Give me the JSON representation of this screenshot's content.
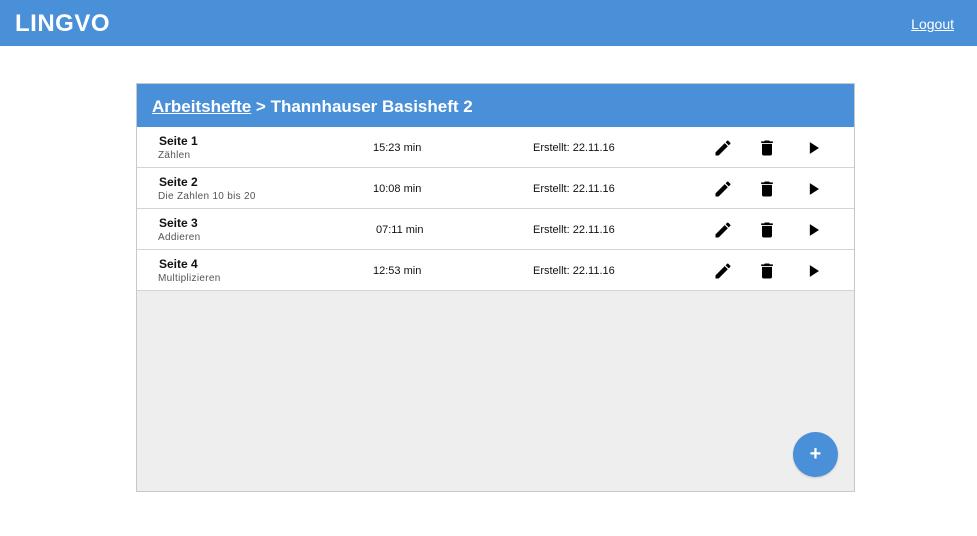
{
  "app": {
    "brand": "LINGVO",
    "logout_label": "Logout"
  },
  "panel": {
    "breadcrumb_link": "Arbeitshefte",
    "breadcrumb_separator": " > ",
    "breadcrumb_current": "Thannhauser Basisheft 2",
    "add_label": "+"
  },
  "rows": [
    {
      "title": "Seite 1",
      "subtitle": "Zählen",
      "duration": "15:23 min",
      "created": "Erstellt: 22.11.16"
    },
    {
      "title": "Seite 2",
      "subtitle": "Die Zahlen 10 bis 20",
      "duration": "10:08 min",
      "created": "Erstellt: 22.11.16"
    },
    {
      "title": "Seite 3",
      "subtitle": "Addieren",
      "duration": "07:11 min",
      "created": "Erstellt: 22.11.16"
    },
    {
      "title": "Seite 4",
      "subtitle": "Multiplizieren",
      "duration": "12:53 min",
      "created": "Erstellt: 22.11.16"
    }
  ],
  "icons": {
    "edit": "pencil-icon",
    "delete": "trash-icon",
    "play": "play-icon"
  },
  "colors": {
    "accent": "#4a90d9",
    "panel_bg": "#eeeeee"
  }
}
